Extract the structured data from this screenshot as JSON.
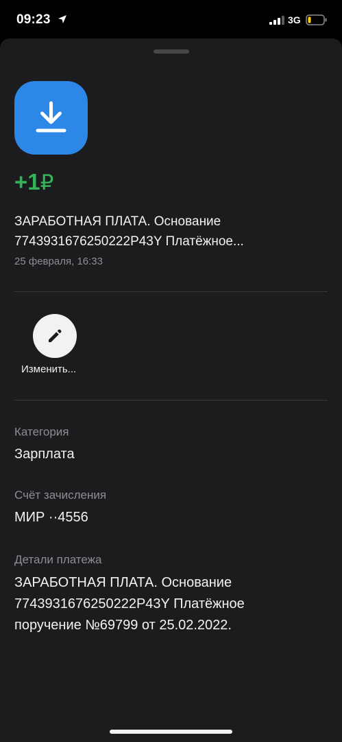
{
  "status_bar": {
    "time": "09:23",
    "network": "3G"
  },
  "transaction": {
    "amount": "+1",
    "currency_symbol": "₽",
    "title_lines": [
      "ЗАРАБОТНАЯ ПЛАТА. Основание",
      "7743931676250222P43Y Платёжное..."
    ],
    "date": "25 февраля, 16:33",
    "icon": "download-icon"
  },
  "actions": {
    "edit_label": "Изменить...",
    "edit_icon": "pencil-icon"
  },
  "fields": {
    "category_label": "Категория",
    "category_value": "Зарплата",
    "account_label": "Счёт зачисления",
    "account_value": "МИР ··4556",
    "details_label": "Детали платежа",
    "details_lines": [
      "ЗАРАБОТНАЯ ПЛАТА. Основание",
      "7743931676250222P43Y Платёжное",
      "поручение №69799 от 25.02.2022."
    ]
  },
  "colors": {
    "income_green": "#33b35a",
    "icon_blue": "#2d87e6",
    "sheet_background": "#1c1c1e"
  }
}
